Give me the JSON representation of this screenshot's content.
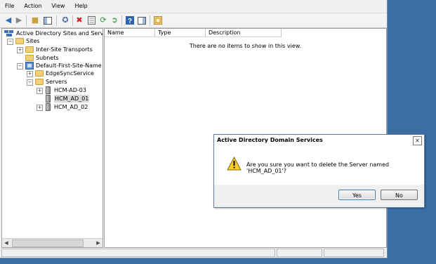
{
  "menu": [
    "File",
    "Action",
    "View",
    "Help"
  ],
  "toolbar": {
    "icons": [
      "back-arrow-icon",
      "forward-arrow-icon",
      "up-folder-icon",
      "show-hide-tree-icon",
      "properties-icon",
      "delete-icon",
      "export-list-icon",
      "refresh-icon",
      "export-icon",
      "help-icon",
      "action-pane-icon",
      "sites-icon"
    ]
  },
  "tree": {
    "root": "Active Directory Sites and Services",
    "sites": "Sites",
    "inter_site_transports": "Inter-Site Transports",
    "subnets": "Subnets",
    "default_site": "Default-First-Site-Name",
    "edgesync": "EdgeSyncService",
    "servers": "Servers",
    "server_items": [
      "HCM-AD-03",
      "HCM_AD_01",
      "HCM_AD_02"
    ],
    "selected": "HCM_AD_01"
  },
  "list": {
    "columns": [
      "Name",
      "Type",
      "Description"
    ],
    "empty_message": "There are no items to show in this view."
  },
  "dialog": {
    "title": "Active Directory Domain Services",
    "message": "Are you sure you want to delete the Server named 'HCM_AD_01'?",
    "yes_label": "Yes",
    "no_label": "No"
  }
}
